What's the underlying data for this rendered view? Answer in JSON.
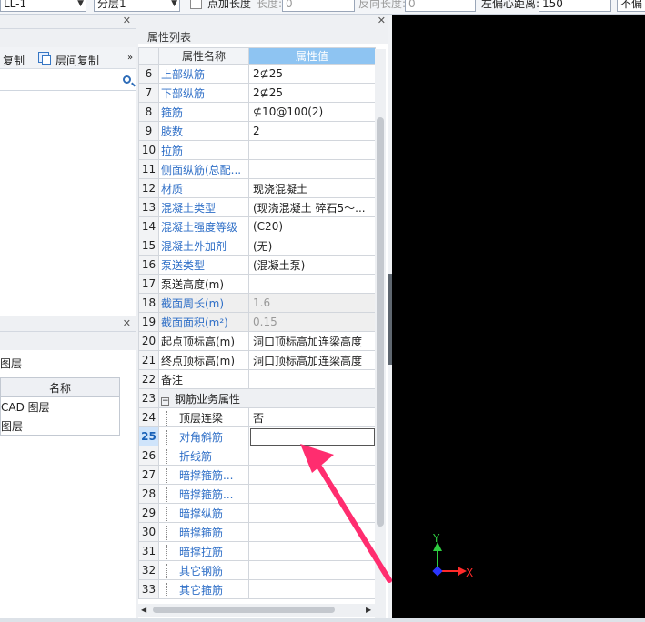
{
  "toolbar": {
    "element_select": "LL-1",
    "layer_select": "分层1",
    "add_length_label": "点加长度",
    "length_label": "长度:",
    "length_value": "0",
    "reverse_length_label": "反向长度:",
    "reverse_length_value": "0",
    "left_offset_label": "左偏心距离:",
    "left_offset_value": "150",
    "last_label": "不偏"
  },
  "left_panel": {
    "copy_label": "复制",
    "floor_copy_label": "层间复制",
    "layer_section_label": "图层",
    "layer_table_header": "名称",
    "layers": [
      "CAD 图层",
      "图层"
    ]
  },
  "properties": {
    "title": "属性列表",
    "col_name": "属性名称",
    "col_value": "属性值",
    "rows": [
      {
        "no": "6",
        "name": "上部纵筋",
        "value": "2⊈25"
      },
      {
        "no": "7",
        "name": "下部纵筋",
        "value": "2⊈25"
      },
      {
        "no": "8",
        "name": "箍筋",
        "value": "⊈10@100(2)"
      },
      {
        "no": "9",
        "name": "肢数",
        "value": "2"
      },
      {
        "no": "10",
        "name": "拉筋",
        "value": ""
      },
      {
        "no": "11",
        "name": "侧面纵筋(总配...",
        "value": ""
      },
      {
        "no": "12",
        "name": "材质",
        "value": "现浇混凝土"
      },
      {
        "no": "13",
        "name": "混凝土类型",
        "value": "(现浇混凝土  碎石5～..."
      },
      {
        "no": "14",
        "name": "混凝土强度等级",
        "value": "(C20)"
      },
      {
        "no": "15",
        "name": "混凝土外加剂",
        "value": "(无)"
      },
      {
        "no": "16",
        "name": "泵送类型",
        "value": "(混凝土泵)"
      },
      {
        "no": "17",
        "name": "泵送高度(m)",
        "value": ""
      },
      {
        "no": "18",
        "name": "截面周长(m)",
        "value": "1.6"
      },
      {
        "no": "19",
        "name": "截面面积(m²)",
        "value": "0.15"
      },
      {
        "no": "20",
        "name": "起点顶标高(m)",
        "value": "洞口顶标高加连梁高度"
      },
      {
        "no": "21",
        "name": "终点顶标高(m)",
        "value": "洞口顶标高加连梁高度"
      },
      {
        "no": "22",
        "name": "备注",
        "value": ""
      },
      {
        "no": "23",
        "name": "钢筋业务属性",
        "value": ""
      },
      {
        "no": "24",
        "name": "顶层连梁",
        "value": "否"
      },
      {
        "no": "25",
        "name": "对角斜筋",
        "value": ""
      },
      {
        "no": "26",
        "name": "折线筋",
        "value": ""
      },
      {
        "no": "27",
        "name": "暗撑箍筋...",
        "value": ""
      },
      {
        "no": "28",
        "name": "暗撑箍筋...",
        "value": ""
      },
      {
        "no": "29",
        "name": "暗撑纵筋",
        "value": ""
      },
      {
        "no": "30",
        "name": "暗撑箍筋",
        "value": ""
      },
      {
        "no": "31",
        "name": "暗撑拉筋",
        "value": ""
      },
      {
        "no": "32",
        "name": "其它钢筋",
        "value": ""
      },
      {
        "no": "33",
        "name": "其它箍筋",
        "value": ""
      }
    ]
  },
  "canvas": {
    "axis_y_label": "Y",
    "axis_x_label": "X",
    "axis_y_color": "#2ecc40",
    "axis_x_color": "#ff2a2a",
    "annotation_arrow_color": "#ff2d6f"
  }
}
